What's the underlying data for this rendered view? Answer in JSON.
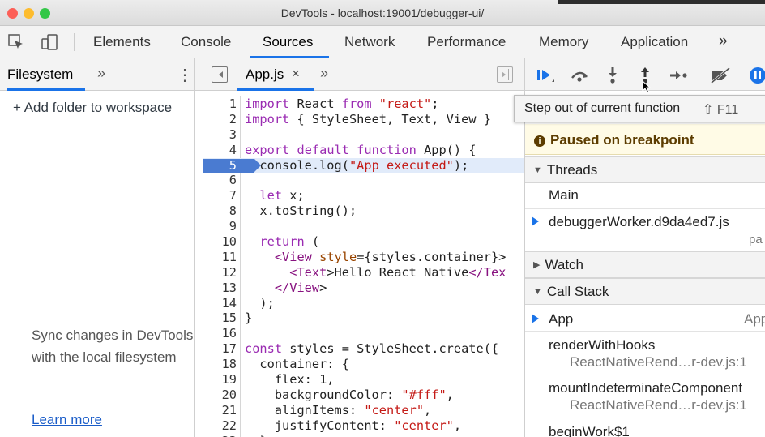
{
  "window": {
    "title": "DevTools - localhost:19001/debugger-ui/",
    "traffic_colors": [
      "#fc5f57",
      "#fdbc2e",
      "#33c748"
    ]
  },
  "main_tabs": [
    "Elements",
    "Console",
    "Sources",
    "Network",
    "Performance",
    "Memory",
    "Application"
  ],
  "main_tabs_more": "»",
  "active_tab": "Sources",
  "left_panel": {
    "tab": "Filesystem",
    "more": "»",
    "menu": "⋮",
    "add_folder": "+ Add folder to workspace",
    "sync_text": "Sync changes in DevTools with the local filesystem",
    "learn_more": "Learn more"
  },
  "editor": {
    "file_tab": "App.js",
    "close": "×",
    "more": "»",
    "breakpoint_line": 5,
    "lines": [
      {
        "n": "1",
        "t": "import React from \"react\";"
      },
      {
        "n": "2",
        "t": "import { StyleSheet, Text, View }"
      },
      {
        "n": "3",
        "t": ""
      },
      {
        "n": "4",
        "t": "export default function App() {"
      },
      {
        "n": "5",
        "t": "  console.log(\"App executed\");"
      },
      {
        "n": "6",
        "t": ""
      },
      {
        "n": "7",
        "t": "  let x;"
      },
      {
        "n": "8",
        "t": "  x.toString();"
      },
      {
        "n": "9",
        "t": ""
      },
      {
        "n": "10",
        "t": "  return ("
      },
      {
        "n": "11",
        "t": "    <View style={styles.container}>"
      },
      {
        "n": "12",
        "t": "      <Text>Hello React Native</Tex"
      },
      {
        "n": "13",
        "t": "    </View>"
      },
      {
        "n": "14",
        "t": "  );"
      },
      {
        "n": "15",
        "t": "}"
      },
      {
        "n": "16",
        "t": ""
      },
      {
        "n": "17",
        "t": "const styles = StyleSheet.create({"
      },
      {
        "n": "18",
        "t": "  container: {"
      },
      {
        "n": "19",
        "t": "    flex: 1,"
      },
      {
        "n": "20",
        "t": "    backgroundColor: \"#fff\","
      },
      {
        "n": "21",
        "t": "    alignItems: \"center\","
      },
      {
        "n": "22",
        "t": "    justifyContent: \"center\","
      },
      {
        "n": "23",
        "t": "  }"
      }
    ]
  },
  "debugger": {
    "tooltip": "Step out of current function",
    "tooltip_shortcut": "⇧ F11",
    "paused": "Paused on breakpoint",
    "threads_header": "Threads",
    "threads": [
      {
        "name": "Main",
        "active": false,
        "note": ""
      },
      {
        "name": "debuggerWorker.d9da4ed7.js",
        "active": true,
        "note": "pa"
      }
    ],
    "watch_header": "Watch",
    "call_stack_header": "Call Stack",
    "call_stack": [
      {
        "fn": "App",
        "loc": "App",
        "active": true
      },
      {
        "fn": "renderWithHooks",
        "loc": "ReactNativeRend…r-dev.js:1",
        "active": false
      },
      {
        "fn": "mountIndeterminateComponent",
        "loc": "ReactNativeRend…r-dev.js:1",
        "active": false
      },
      {
        "fn": "beginWork$1",
        "loc": "",
        "active": false
      }
    ]
  }
}
